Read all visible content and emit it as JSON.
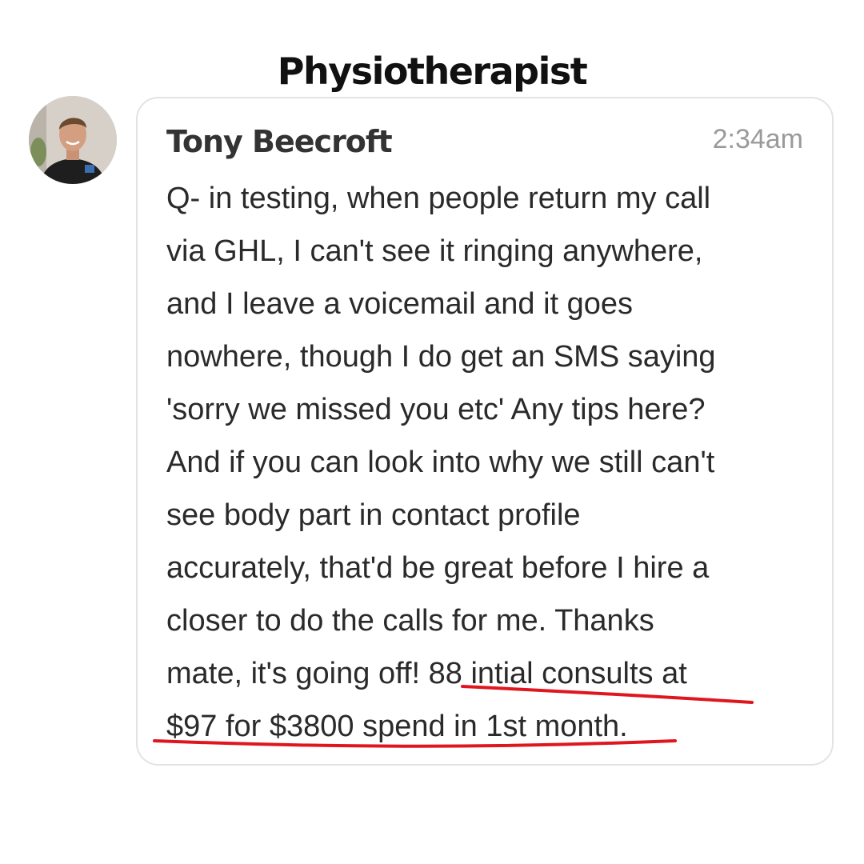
{
  "page": {
    "title": "Physiotherapist"
  },
  "message": {
    "author": "Tony Beecroft",
    "time": "2:34am",
    "lines": [
      "Q- in testing, when people return my call",
      "via GHL, I can't see it ringing anywhere,",
      "and I leave a voicemail and it goes",
      "nowhere, though I do get an SMS saying",
      "'sorry we missed you etc' Any tips here?",
      "And if you can look into why we still can't",
      "see body part in contact profile",
      "accurately, that'd be great before I hire a",
      "closer to do the calls for me. Thanks",
      "mate, it's going off! 88 intial consults at",
      "$97 for $3800 spend in 1st month."
    ]
  },
  "colors": {
    "underline": "#e0161f",
    "timestamp": "#9a9a9a",
    "card_border": "#e3e3e3"
  },
  "icons": {
    "avatar": "profile-photo"
  }
}
